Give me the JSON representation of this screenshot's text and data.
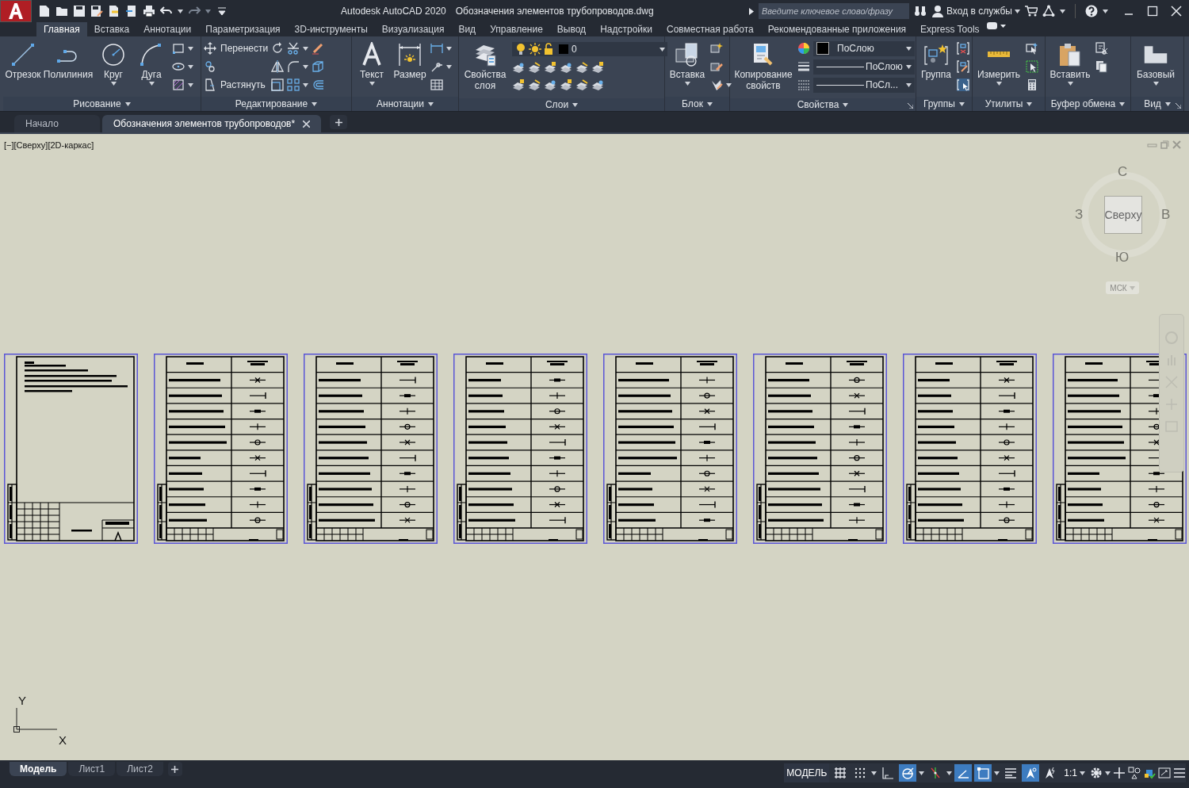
{
  "window": {
    "app_name": "Autodesk AutoCAD 2020",
    "file_name": "Обозначения элементов трубопроводов.dwg"
  },
  "search": {
    "placeholder": "Введите ключевое слово/фразу"
  },
  "sign_in": {
    "label": "Вход в службы"
  },
  "ribbon_tabs": [
    {
      "label": "Главная",
      "selected": true
    },
    {
      "label": "Вставка",
      "selected": false
    },
    {
      "label": "Аннотации",
      "selected": false
    },
    {
      "label": "Параметризация",
      "selected": false
    },
    {
      "label": "3D-инструменты",
      "selected": false
    },
    {
      "label": "Визуализация",
      "selected": false
    },
    {
      "label": "Вид",
      "selected": false
    },
    {
      "label": "Управление",
      "selected": false
    },
    {
      "label": "Вывод",
      "selected": false
    },
    {
      "label": "Надстройки",
      "selected": false
    },
    {
      "label": "Совместная работа",
      "selected": false
    },
    {
      "label": "Рекомендованные приложения",
      "selected": false
    },
    {
      "label": "Express Tools",
      "selected": false
    }
  ],
  "panels": [
    {
      "kind": "draw",
      "title": "Рисование",
      "buttons": [
        {
          "kind": "line",
          "label": "Отрезок",
          "dropdown": false
        },
        {
          "kind": "polyline",
          "label": "Полилиния",
          "dropdown": false
        },
        {
          "kind": "circle",
          "label": "Круг",
          "dropdown": true
        },
        {
          "kind": "arc",
          "label": "Дуга",
          "dropdown": true
        }
      ]
    },
    {
      "kind": "modify",
      "title": "Редактирование",
      "tools": [
        "Перенести",
        "Растянуть"
      ]
    },
    {
      "kind": "annotation",
      "title": "Аннотации",
      "buttons": [
        {
          "kind": "text",
          "label": "Текст",
          "dropdown": true
        },
        {
          "kind": "dimension",
          "label": "Размер",
          "dropdown": false
        }
      ]
    },
    {
      "kind": "layers",
      "title": "Слои",
      "buttons": [
        {
          "kind": "layer_properties",
          "label": "Свойства слоя",
          "dropdown": false
        }
      ],
      "layer": "0"
    },
    {
      "kind": "block",
      "title": "Блок",
      "buttons": [
        {
          "kind": "insert",
          "label": "Вставка",
          "dropdown": true
        }
      ]
    },
    {
      "kind": "properties",
      "title": "Свойства",
      "buttons": [
        {
          "kind": "match_properties",
          "label": "Копирование свойств",
          "dropdown": false
        }
      ],
      "dropdowns": [
        "ПоСлою",
        "ПоСлою",
        "ПоСл..."
      ]
    },
    {
      "kind": "groups",
      "title": "Группы",
      "buttons": [
        {
          "kind": "group",
          "label": "Группа",
          "dropdown": false
        }
      ]
    },
    {
      "kind": "utilities",
      "title": "Утилиты",
      "buttons": [
        {
          "kind": "measure",
          "label": "Измерить",
          "dropdown": true
        }
      ]
    },
    {
      "kind": "clipboard",
      "title": "Буфер обмена",
      "buttons": [
        {
          "kind": "paste",
          "label": "Вставить",
          "dropdown": true
        }
      ]
    },
    {
      "kind": "view",
      "title": "Вид",
      "buttons": [
        {
          "kind": "base",
          "label": "Базовый",
          "dropdown": true
        }
      ]
    }
  ],
  "doc_tabs": [
    {
      "label": "Начало",
      "selected": false
    },
    {
      "label": "Обозначения элементов трубопроводов*",
      "selected": true
    }
  ],
  "viewport": {
    "label": "[−][Сверху][2D-каркас]"
  },
  "viewcube": {
    "north": "С",
    "west": "З",
    "east": "В",
    "south": "Ю",
    "face": "Сверху",
    "ucs": "МСК"
  },
  "ucs_icon": {
    "y": "Y",
    "x": "X"
  },
  "sheets": [
    {
      "kind": "title_page"
    },
    {
      "kind": "symbol_table"
    },
    {
      "kind": "symbol_table"
    },
    {
      "kind": "symbol_table"
    },
    {
      "kind": "symbol_table"
    },
    {
      "kind": "symbol_table"
    },
    {
      "kind": "symbol_table"
    },
    {
      "kind": "symbol_table"
    }
  ],
  "layout_tabs": [
    {
      "label": "Модель",
      "selected": true
    },
    {
      "label": "Лист1",
      "selected": false
    },
    {
      "label": "Лист2",
      "selected": false
    }
  ],
  "status_bar": {
    "model": "МОДЕЛЬ",
    "scale": "1:1",
    "toggles": [
      {
        "kind": "grid",
        "on": false
      },
      {
        "kind": "snap",
        "on": false
      },
      {
        "kind": "ortho",
        "on": false
      },
      {
        "kind": "polar",
        "on": true
      },
      {
        "kind": "osnap_tracking",
        "on": false
      },
      {
        "kind": "dynamic_input",
        "on": true
      },
      {
        "kind": "selection_cycling",
        "on": true
      },
      {
        "kind": "lineweight",
        "on": false
      },
      {
        "kind": "annotation_visibility",
        "on": true
      },
      {
        "kind": "autoscale",
        "on": false
      }
    ]
  }
}
